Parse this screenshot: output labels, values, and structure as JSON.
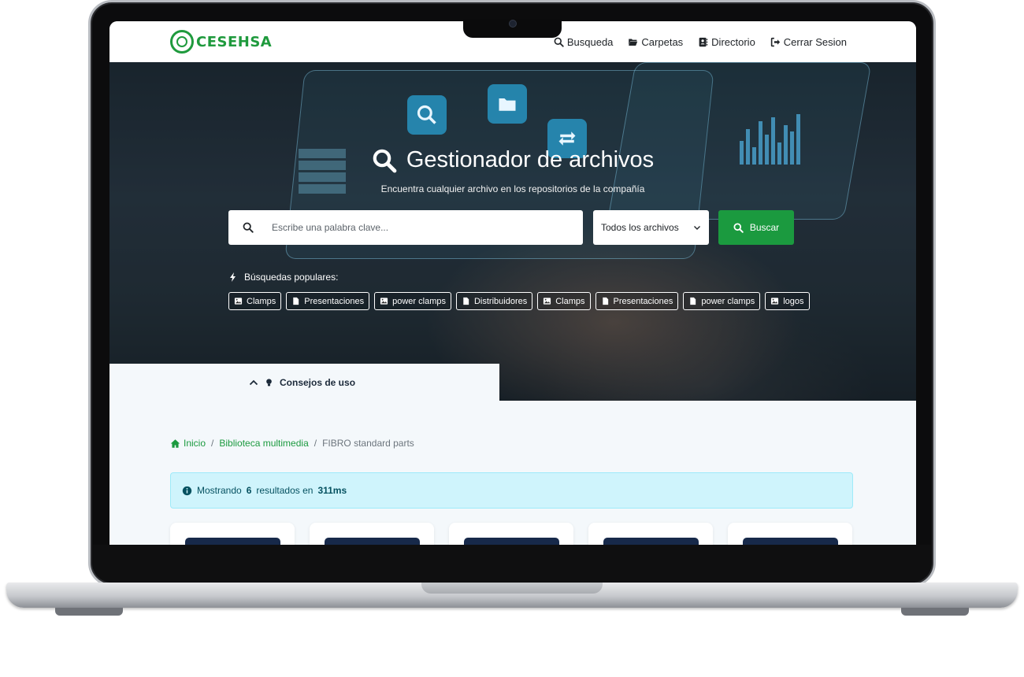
{
  "brand": {
    "name": "CESEHSA",
    "color": "#1f9a3d"
  },
  "nav": {
    "items": [
      {
        "label": "Busqueda",
        "icon": "search-icon"
      },
      {
        "label": "Carpetas",
        "icon": "folder-open-icon"
      },
      {
        "label": "Directorio",
        "icon": "address-book-icon"
      },
      {
        "label": "Cerrar Sesion",
        "icon": "sign-out-icon"
      }
    ]
  },
  "hero": {
    "title": "Gestionador de archivos",
    "subtitle": "Encuentra cualquier archivo en los repositorios de la compañía",
    "search_placeholder": "Escribe una palabra clave...",
    "filter_selected": "Todos los archivos",
    "search_button": "Buscar",
    "popular_label": "Búsquedas populares:",
    "popular": [
      {
        "label": "Clamps",
        "icon": "image-icon"
      },
      {
        "label": "Presentaciones",
        "icon": "file-icon"
      },
      {
        "label": "power clamps",
        "icon": "image-icon"
      },
      {
        "label": "Distribuidores",
        "icon": "file-icon"
      },
      {
        "label": "Clamps",
        "icon": "image-icon"
      },
      {
        "label": "Presentaciones",
        "icon": "file-icon"
      },
      {
        "label": "power clamps",
        "icon": "file-icon"
      },
      {
        "label": "logos",
        "icon": "image-icon"
      }
    ],
    "tips_label": "Consejos de uso"
  },
  "breadcrumb": {
    "home": "Inicio",
    "library": "Biblioteca multimedia",
    "current": "FIBRO standard parts"
  },
  "results": {
    "prefix": "Mostrando",
    "count": "6",
    "middle": "resultados en",
    "time": "311ms"
  },
  "cards": [
    {},
    {},
    {},
    {},
    {}
  ],
  "colors": {
    "accent": "#1b9a3f",
    "info_bg": "#cff4fc",
    "info_text": "#055160",
    "card_thumb": "#17294a"
  }
}
